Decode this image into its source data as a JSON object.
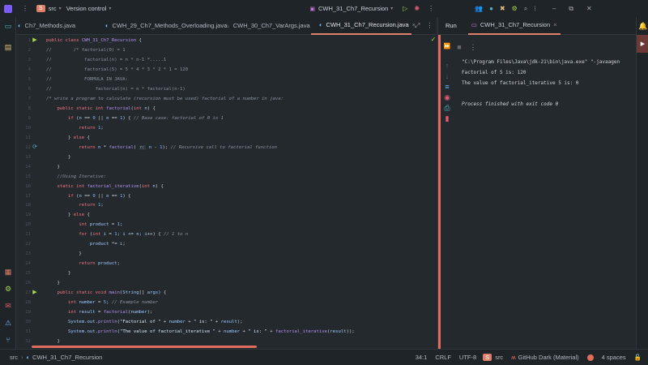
{
  "titlebar": {
    "project_badge": "S",
    "project": "src",
    "vcs": "Version control",
    "run_config": "CWH_31_Ch7_Recursion"
  },
  "tabs": [
    {
      "label": "Ch7_Methods.java",
      "active": false
    },
    {
      "label": "CWH_29_Ch7_Methods_Overloading.java",
      "active": false
    },
    {
      "label": "CWH_30_Ch7_VarArgs.java",
      "active": false
    },
    {
      "label": "CWH_31_Ch7_Recursion.java",
      "active": true
    }
  ],
  "code_lines": [
    "public class CWH_31_Ch7_Recursion {",
    "//        /* factorial(0) = 1",
    "//            factorial(n) = n * n-1 *.....1",
    "//            factorial(5) = 5 * 4 * 3 * 2 * 1 = 120",
    "//            FORMULA IN JAVA:",
    "//                factorial(n) = n * factorial(n-1)",
    "/* write a program to calculate (recursion must be used) factorial of a number in java:",
    "    public static int factorial(int n) {",
    "        if (n == 0 || n == 1) { // Base case: factorial of 0 is 1",
    "            return 1;",
    "        } else {",
    "            return n * factorial( n: n - 1); // Recursive call to factorial function",
    "        }",
    "    }",
    "    //Using Iterative:",
    "    static int factorial_iterative(int n) {",
    "        if (n == 0 || n == 1) {",
    "            return 1;",
    "        } else {",
    "            int product = 1;",
    "            for (int i = 1; i <= n; i++) { // 1 to n",
    "                product *= i;",
    "            }",
    "            return product;",
    "        }",
    "    }",
    "    public static void main(String[] args) {",
    "        int number = 5; // Example number",
    "        int result = factorial(number);",
    "        System.out.println(\"Factorial of \" + number + \" is: \" + result);",
    "        System.out.println(\"The value of factorial_iterative \" + number + \" is: \" + factorial_iterative(result));",
    "    }"
  ],
  "run_panel": {
    "tab_run": "Run",
    "tab_config": "CWH_31_Ch7_Recursion",
    "output": [
      "\"C:\\Program Files\\Java\\jdk-21\\bin\\java.exe\" \"-javaagen",
      "Factorial of 5 is: 120",
      "The value of factorial_iterative 5 is: 0",
      "",
      "Process finished with exit code 0"
    ]
  },
  "statusbar": {
    "breadcrumb_root": "src",
    "breadcrumb_file": "CWH_31_Ch7_Recursion",
    "position": "34:1",
    "line_sep": "CRLF",
    "encoding": "UTF-8",
    "module_badge": "S",
    "module": "src",
    "theme": "GitHub Dark (Material)",
    "indent": "4 spaces"
  },
  "colors": {
    "accent": "#e0806a",
    "run_green": "#a6d74f",
    "keyword": "#f97583"
  }
}
